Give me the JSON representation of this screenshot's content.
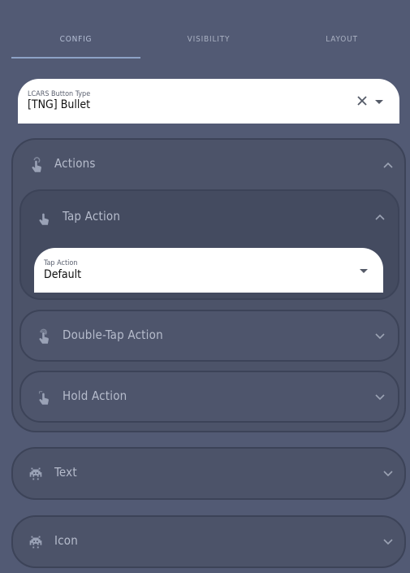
{
  "tabs": {
    "config": "Config",
    "visibility": "Visibility",
    "layout": "Layout"
  },
  "button_type": {
    "label": "LCARS Button Type",
    "value": "[TNG] Bullet"
  },
  "sections": {
    "actions": {
      "title": "Actions",
      "tap_action": {
        "title": "Tap Action",
        "field_label": "Tap Action",
        "field_value": "Default"
      },
      "double_tap_action": {
        "title": "Double-Tap Action"
      },
      "hold_action": {
        "title": "Hold Action"
      }
    },
    "text": {
      "title": "Text"
    },
    "icon": {
      "title": "Icon"
    }
  },
  "colors": {
    "background": "#525a74",
    "panel": "#4c5369",
    "panel_border": "#3c4358",
    "tab_indicator": "#8da2c6",
    "field_background": "#ffffff"
  },
  "icons": {
    "actions": "gesture-tap-icon",
    "tap_action": "gesture-tap-icon",
    "double_tap_action": "gesture-double-tap-icon",
    "hold_action": "gesture-tap-hold-icon",
    "text": "space-invaders-icon",
    "icon": "space-invaders-icon"
  }
}
